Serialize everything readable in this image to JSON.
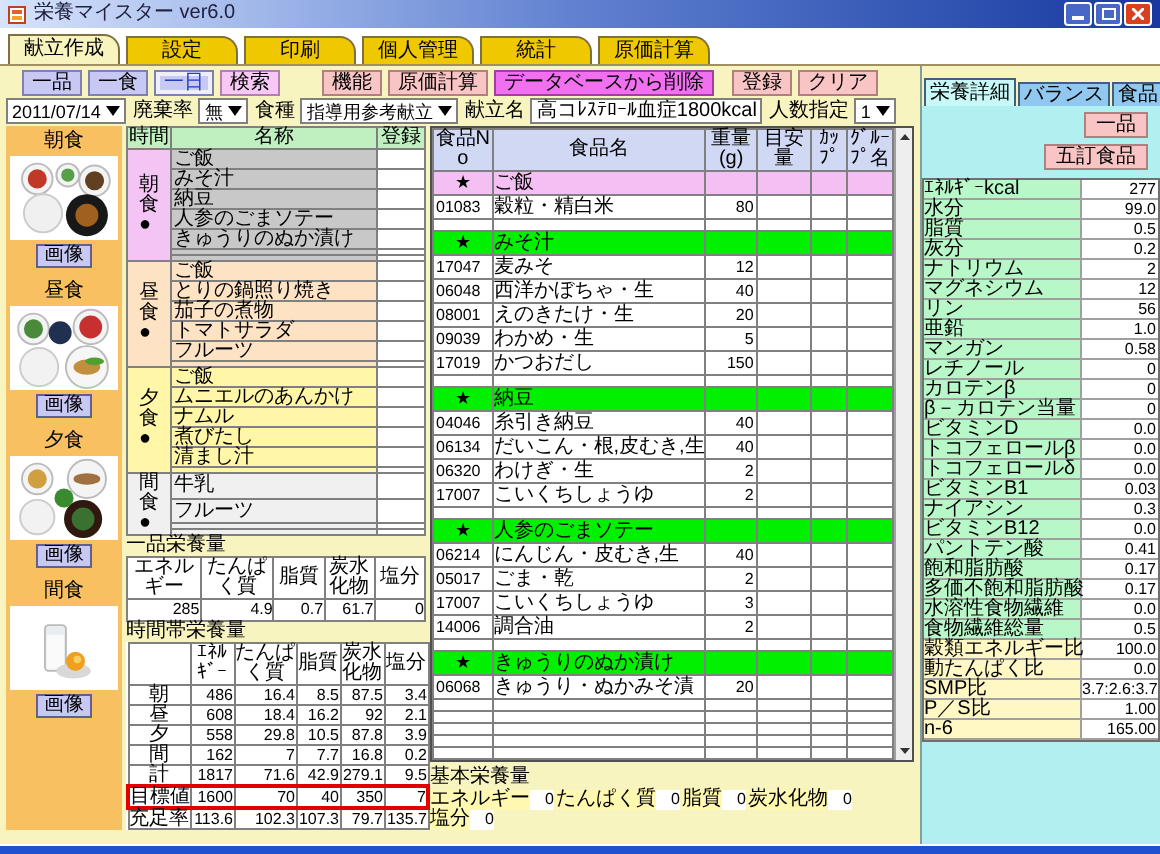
{
  "window": {
    "title": "栄養マイスター ver6.0"
  },
  "tabs": [
    {
      "label": "献立作成",
      "selected": true
    },
    {
      "label": "設定",
      "selected": false
    },
    {
      "label": "印刷",
      "selected": false
    },
    {
      "label": "個人管理",
      "selected": false
    },
    {
      "label": "統計",
      "selected": false
    },
    {
      "label": "原価計算",
      "selected": false
    }
  ],
  "toolbar": [
    {
      "label": "一品",
      "kind": "view",
      "selected": false
    },
    {
      "label": "一食",
      "kind": "view",
      "selected": false
    },
    {
      "label": "一日",
      "kind": "view",
      "selected": true
    },
    {
      "label": "検索",
      "kind": "search",
      "selected": false
    },
    {
      "label": "機能",
      "kind": "function",
      "selected": false
    },
    {
      "label": "原価計算",
      "kind": "function",
      "selected": false
    },
    {
      "label": "データベースから削除",
      "kind": "delete",
      "selected": false
    },
    {
      "label": "登録",
      "kind": "function",
      "selected": false
    },
    {
      "label": "クリア",
      "kind": "function",
      "selected": false
    }
  ],
  "filters": [
    {
      "kind": "select",
      "value": "2011/07/14"
    },
    {
      "kind": "label",
      "text": "廃棄率"
    },
    {
      "kind": "select",
      "value": "無"
    },
    {
      "kind": "label",
      "text": "食種"
    },
    {
      "kind": "select",
      "value": "指導用参考献立"
    },
    {
      "kind": "label",
      "text": "献立名"
    },
    {
      "kind": "field",
      "value": "高コﾚｽﾃﾛｰﾙ血症1800kcal"
    },
    {
      "kind": "label",
      "text": "人数指定"
    },
    {
      "kind": "select",
      "value": "1"
    }
  ],
  "meal_photos": [
    {
      "label": "朝食",
      "button": "画像"
    },
    {
      "label": "昼食",
      "button": "画像"
    },
    {
      "label": "夕食",
      "button": "画像"
    },
    {
      "label": "間食",
      "button": "画像"
    }
  ],
  "menu_table": {
    "columns": [
      "時間",
      "名称",
      "登録"
    ],
    "groups": [
      {
        "label": "朝食●",
        "color": "#f4c4f4",
        "selected": true,
        "items": [
          {
            "kind": "dish",
            "name": "ご飯"
          },
          {
            "kind": "dish",
            "name": "みそ汁"
          },
          {
            "kind": "dish",
            "name": "納豆"
          },
          {
            "kind": "dish",
            "name": "人参のごまソテー"
          },
          {
            "kind": "dish",
            "name": "きゅうりのぬか漬け"
          },
          {
            "kind": "empty"
          },
          {
            "kind": "empty"
          }
        ]
      },
      {
        "label": "昼食●",
        "color": "#fde2c4",
        "selected": false,
        "items": [
          {
            "kind": "dish",
            "name": "ご飯"
          },
          {
            "kind": "dish",
            "name": "とりの鍋照り焼き"
          },
          {
            "kind": "dish",
            "name": "茄子の煮物"
          },
          {
            "kind": "dish",
            "name": "トマトサラダ"
          },
          {
            "kind": "dish",
            "name": "フルーツ"
          },
          {
            "kind": "empty"
          }
        ]
      },
      {
        "label": "夕食●",
        "color": "#fff6a8",
        "selected": false,
        "items": [
          {
            "kind": "dish",
            "name": "ご飯"
          },
          {
            "kind": "dish",
            "name": "ムニエルのあんかけ"
          },
          {
            "kind": "dish",
            "name": "ナムル"
          },
          {
            "kind": "dish",
            "name": "煮びたし"
          },
          {
            "kind": "dish",
            "name": "清まし汁"
          },
          {
            "kind": "empty"
          }
        ]
      },
      {
        "label": "間食●",
        "color": "#f0f0f0",
        "selected": false,
        "items": [
          {
            "kind": "dish",
            "name": "牛乳"
          },
          {
            "kind": "dish",
            "name": "フルーツ"
          },
          {
            "kind": "empty"
          },
          {
            "kind": "empty"
          }
        ]
      }
    ]
  },
  "item_nutrition": {
    "title": "一品栄養量",
    "columns": [
      "エネルギー",
      "たんぱく質",
      "脂質",
      "炭水化物",
      "塩分"
    ],
    "values": [
      "285",
      "4.9",
      "0.7",
      "61.7",
      "0"
    ]
  },
  "period_nutrition": {
    "title": "時間帯栄養量",
    "columns": [
      "ｴﾈﾙｷﾞｰ",
      "たんぱく質",
      "脂質",
      "炭水化物",
      "塩分"
    ],
    "rows": [
      {
        "label": "朝",
        "highlighted": false,
        "values": [
          "486",
          "16.4",
          "8.5",
          "87.5",
          "3.4"
        ]
      },
      {
        "label": "昼",
        "highlighted": false,
        "values": [
          "608",
          "18.4",
          "16.2",
          "92",
          "2.1"
        ]
      },
      {
        "label": "夕",
        "highlighted": false,
        "values": [
          "558",
          "29.8",
          "10.5",
          "87.8",
          "3.9"
        ]
      },
      {
        "label": "間",
        "highlighted": false,
        "values": [
          "162",
          "7",
          "7.7",
          "16.8",
          "0.2"
        ]
      },
      {
        "label": "計",
        "highlighted": false,
        "values": [
          "1817",
          "71.6",
          "42.9",
          "279.1",
          "9.5"
        ]
      },
      {
        "label": "目標値",
        "highlighted": true,
        "values": [
          "1600",
          "70",
          "40",
          "350",
          "7"
        ]
      },
      {
        "label": "充足率",
        "highlighted": false,
        "values": [
          "113.6",
          "102.3",
          "107.3",
          "79.7",
          "135.7"
        ]
      }
    ]
  },
  "food_table": {
    "columns": [
      "食品No",
      "食品名",
      "重量(g)",
      "目安量",
      "ｶｯﾌﾟ",
      "ｸﾞﾙｰﾌﾟ名"
    ],
    "rows": [
      {
        "kind": "dish",
        "marker": "★",
        "name": "ご飯",
        "selected": true
      },
      {
        "kind": "food",
        "no": "01083",
        "name": "穀粒・精白米",
        "weight": "80",
        "selected": false
      },
      {
        "kind": "empty"
      },
      {
        "kind": "dish",
        "marker": "★",
        "name": "みそ汁",
        "selected": false
      },
      {
        "kind": "food",
        "no": "17047",
        "name": "麦みそ",
        "weight": "12",
        "selected": false
      },
      {
        "kind": "food",
        "no": "06048",
        "name": "西洋かぼちゃ・生",
        "weight": "40",
        "selected": false
      },
      {
        "kind": "food",
        "no": "08001",
        "name": "えのきたけ・生",
        "weight": "20",
        "selected": false
      },
      {
        "kind": "food",
        "no": "09039",
        "name": "わかめ・生",
        "weight": "5",
        "selected": false
      },
      {
        "kind": "food",
        "no": "17019",
        "name": "かつおだし",
        "weight": "150",
        "selected": false
      },
      {
        "kind": "empty"
      },
      {
        "kind": "dish",
        "marker": "★",
        "name": "納豆",
        "selected": false
      },
      {
        "kind": "food",
        "no": "04046",
        "name": "糸引き納豆",
        "weight": "40",
        "selected": false
      },
      {
        "kind": "food",
        "no": "06134",
        "name": "だいこん・根,皮むき,生",
        "weight": "40",
        "selected": false
      },
      {
        "kind": "food",
        "no": "06320",
        "name": "わけぎ・生",
        "weight": "2",
        "selected": false
      },
      {
        "kind": "food",
        "no": "17007",
        "name": "こいくちしょうゆ",
        "weight": "2",
        "selected": false
      },
      {
        "kind": "empty"
      },
      {
        "kind": "dish",
        "marker": "★",
        "name": "人参のごまソテー",
        "selected": false
      },
      {
        "kind": "food",
        "no": "06214",
        "name": "にんじん・皮むき,生",
        "weight": "40",
        "selected": false
      },
      {
        "kind": "food",
        "no": "05017",
        "name": "ごま・乾",
        "weight": "2",
        "selected": false
      },
      {
        "kind": "food",
        "no": "17007",
        "name": "こいくちしょうゆ",
        "weight": "3",
        "selected": false
      },
      {
        "kind": "food",
        "no": "14006",
        "name": "調合油",
        "weight": "2",
        "selected": false
      },
      {
        "kind": "empty"
      },
      {
        "kind": "dish",
        "marker": "★",
        "name": "きゅうりのぬか漬け",
        "selected": false
      },
      {
        "kind": "food",
        "no": "06068",
        "name": "きゅうり・ぬかみそ漬",
        "weight": "20",
        "selected": false
      },
      {
        "kind": "empty"
      },
      {
        "kind": "empty"
      },
      {
        "kind": "empty"
      },
      {
        "kind": "empty"
      },
      {
        "kind": "empty"
      }
    ]
  },
  "basic_nutrition": {
    "title": "基本栄養量",
    "items": [
      {
        "label": "エネルギー",
        "value": "0"
      },
      {
        "label": "たんぱく質",
        "value": "0"
      },
      {
        "label": "脂質",
        "value": "0"
      },
      {
        "label": "炭水化物",
        "value": "0"
      },
      {
        "label": "塩分",
        "value": "0"
      }
    ]
  },
  "side_panel": {
    "tabs": [
      {
        "label": "栄養詳細",
        "selected": true
      },
      {
        "label": "バランス",
        "selected": false
      },
      {
        "label": "食品",
        "selected": false
      }
    ],
    "buttons": [
      "一品",
      "五訂食品"
    ],
    "nutrients": [
      {
        "kind": "nutrient",
        "label": "ｴﾈﾙｷﾞｰkcal",
        "value": "277"
      },
      {
        "kind": "nutrient",
        "label": "水分",
        "value": "99.0"
      },
      {
        "kind": "nutrient",
        "label": "脂質",
        "value": "0.5"
      },
      {
        "kind": "nutrient",
        "label": "灰分",
        "value": "0.2"
      },
      {
        "kind": "nutrient",
        "label": "ナトリウム",
        "value": "2"
      },
      {
        "kind": "nutrient",
        "label": "マグネシウム",
        "value": "12"
      },
      {
        "kind": "nutrient",
        "label": "リン",
        "value": "56"
      },
      {
        "kind": "nutrient",
        "label": "亜鉛",
        "value": "1.0"
      },
      {
        "kind": "nutrient",
        "label": "マンガン",
        "value": "0.58"
      },
      {
        "kind": "nutrient",
        "label": "レチノール",
        "value": "0"
      },
      {
        "kind": "nutrient",
        "label": "カロテンβ",
        "value": "0"
      },
      {
        "kind": "nutrient",
        "label": "β－カロテン当量",
        "value": "0"
      },
      {
        "kind": "nutrient",
        "label": "ビタミンD",
        "value": "0.0"
      },
      {
        "kind": "nutrient",
        "label": "トコフェロールβ",
        "value": "0.0"
      },
      {
        "kind": "nutrient",
        "label": "トコフェロールδ",
        "value": "0.0"
      },
      {
        "kind": "nutrient",
        "label": "ビタミンB1",
        "value": "0.03"
      },
      {
        "kind": "nutrient",
        "label": "ナイアシン",
        "value": "0.3"
      },
      {
        "kind": "nutrient",
        "label": "ビタミンB12",
        "value": "0.0"
      },
      {
        "kind": "nutrient",
        "label": "パントテン酸",
        "value": "0.41"
      },
      {
        "kind": "nutrient",
        "label": "飽和脂肪酸",
        "value": "0.17"
      },
      {
        "kind": "nutrient",
        "label": "多価不飽和脂肪酸",
        "value": "0.17"
      },
      {
        "kind": "nutrient",
        "label": "水溶性食物繊維",
        "value": "0.0"
      },
      {
        "kind": "nutrient",
        "label": "食物繊維総量",
        "value": "0.5"
      },
      {
        "kind": "ratio",
        "label": "穀類エネルギー比",
        "value": "100.0"
      },
      {
        "kind": "ratio",
        "label": "動たんぱく比",
        "value": "0.0"
      },
      {
        "kind": "ratio",
        "label": "SMP比",
        "value": "3.7:2.6:3.7"
      },
      {
        "kind": "ratio",
        "label": "P／S比",
        "value": "1.00"
      },
      {
        "kind": "ratio",
        "label": "n-6",
        "value": "165.00"
      }
    ]
  }
}
